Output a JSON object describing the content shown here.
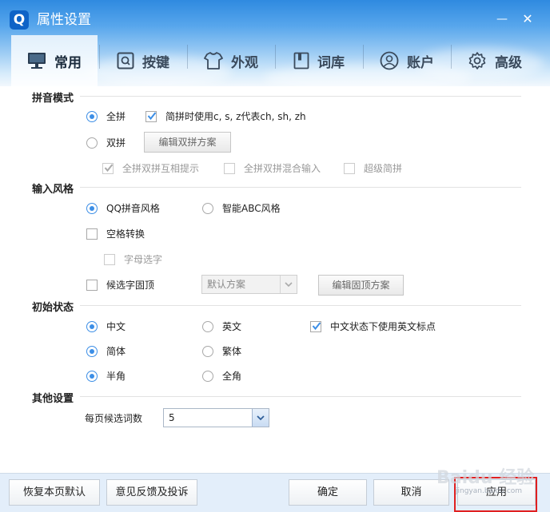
{
  "window": {
    "logo_letter": "Q",
    "title": "属性设置",
    "minimize_glyph": "—",
    "close_glyph": "✕"
  },
  "tabs": [
    {
      "label": "常用",
      "icon": "monitor-icon",
      "active": true
    },
    {
      "label": "按键",
      "icon": "q-key-icon",
      "active": false
    },
    {
      "label": "外观",
      "icon": "shirt-icon",
      "active": false
    },
    {
      "label": "词库",
      "icon": "book-icon",
      "active": false
    },
    {
      "label": "账户",
      "icon": "user-icon",
      "active": false
    },
    {
      "label": "高级",
      "icon": "gear-icon",
      "active": false
    }
  ],
  "pinyin_mode": {
    "title": "拼音模式",
    "quanpin": "全拼",
    "jianpin_check": "简拼时使用c, s, z代表ch, sh, zh",
    "shuangpin": "双拼",
    "edit_shuangpin_button": "编辑双拼方案",
    "mutual_hint": "全拼双拼互相提示",
    "mixed_input": "全拼双拼混合输入",
    "super_jianpin": "超级简拼",
    "selected": "quanpin"
  },
  "input_style": {
    "title": "输入风格",
    "qq_style": "QQ拼音风格",
    "abc_style": "智能ABC风格",
    "space_convert": "空格转换",
    "letter_select": "字母选字",
    "pin_candidate": "候选字固顶",
    "scheme_select": "默认方案",
    "edit_pin_button": "编辑固顶方案"
  },
  "initial_state": {
    "title": "初始状态",
    "chinese": "中文",
    "english": "英文",
    "english_punct": "中文状态下使用英文标点",
    "simplified": "简体",
    "traditional": "繁体",
    "half_width": "半角",
    "full_width": "全角"
  },
  "other": {
    "title": "其他设置",
    "candidates_label": "每页候选词数",
    "candidates_value": "5"
  },
  "footer": {
    "restore_default": "恢复本页默认",
    "feedback": "意见反馈及投诉",
    "ok": "确定",
    "cancel": "取消",
    "apply": "应用"
  },
  "watermark": {
    "text": "Baidu 经验",
    "url": "jingyan.baidu.com"
  },
  "colors": {
    "accent": "#3c8ee6",
    "title_bar": "#2f8ae0",
    "highlight_box": "#e02020"
  }
}
